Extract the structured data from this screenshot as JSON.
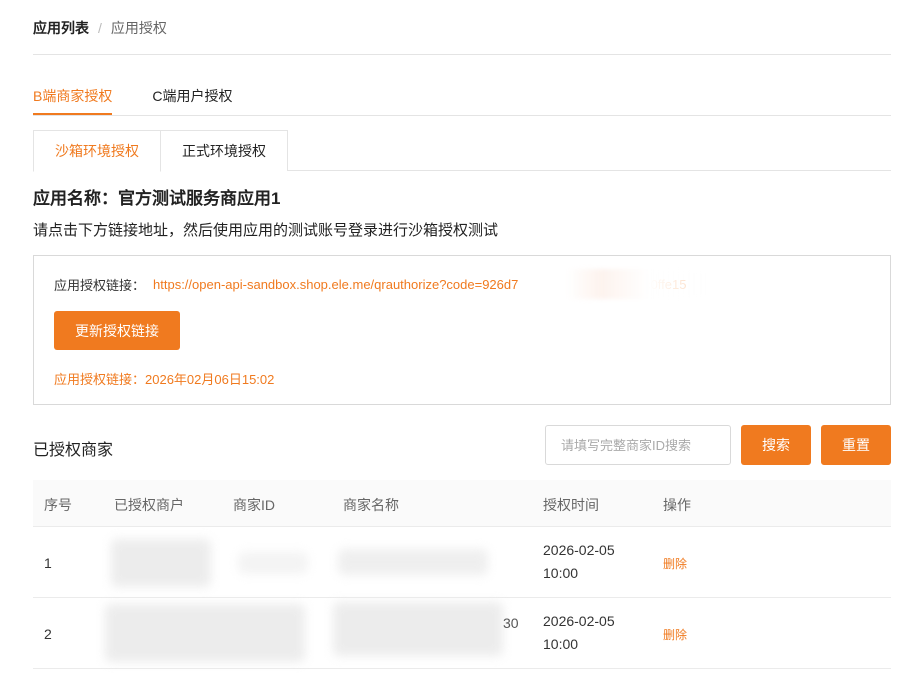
{
  "breadcrumb": {
    "root": "应用列表",
    "separator": "/",
    "current": "应用授权"
  },
  "tabs": [
    {
      "label": "B端商家授权",
      "active": true
    },
    {
      "label": "C端用户授权",
      "active": false
    }
  ],
  "subtabs": [
    {
      "label": "沙箱环境授权",
      "active": true
    },
    {
      "label": "正式环境授权",
      "active": false
    }
  ],
  "app_name": "应用名称：官方测试服务商应用1",
  "instruction": "请点击下方链接地址，然后使用应用的测试账号登录进行沙箱授权测试",
  "auth": {
    "link_label": "应用授权链接：",
    "link_url": "https://open-api-sandbox.shop.ele.me/qrauthorize?code=926d7                         be5dcc0ffe15",
    "refresh_button": "更新授权链接",
    "time_text": "应用授权链接：2026年02月06日15:02"
  },
  "merchants": {
    "title": "已授权商家",
    "search_placeholder": "请填写完整商家ID搜索",
    "search_button": "搜索",
    "reset_button": "重置",
    "columns": [
      "序号",
      "已授权商户",
      "商家ID",
      "商家名称",
      "授权时间",
      "操作"
    ],
    "rows": [
      {
        "index": "1",
        "time": "2026-02-05 10:00",
        "action": "删除",
        "tail": ""
      },
      {
        "index": "2",
        "time": "2026-02-05 10:00",
        "action": "删除",
        "tail": "30"
      }
    ]
  },
  "colors": {
    "accent": "#f07a1f",
    "border": "#e4e4e4"
  }
}
